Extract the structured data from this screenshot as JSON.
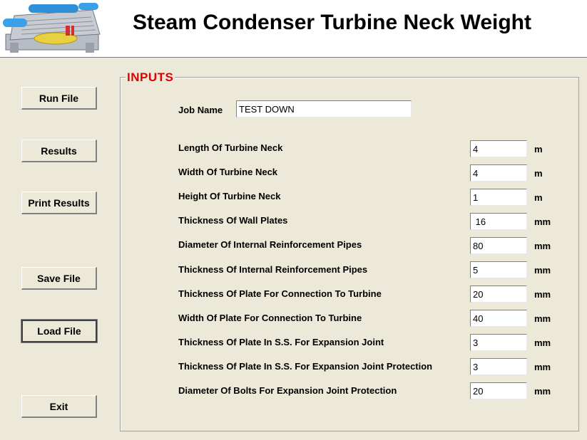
{
  "header": {
    "title": "Steam Condenser Turbine Neck Weight"
  },
  "sidebar": {
    "run_file": "Run File",
    "results": "Results",
    "print_results": "Print Results",
    "save_file": "Save File",
    "load_file": "Load File",
    "exit": "Exit"
  },
  "inputs": {
    "legend": "INPUTS",
    "job_name_label": "Job Name",
    "job_name_value": "TEST DOWN",
    "rows": [
      {
        "label": "Length Of Turbine Neck",
        "value": "4",
        "unit": "m"
      },
      {
        "label": "Width Of Turbine Neck",
        "value": "4",
        "unit": "m"
      },
      {
        "label": "Height Of Turbine Neck",
        "value": "1",
        "unit": "m"
      },
      {
        "label": "Thickness Of Wall Plates",
        "value": " 16",
        "unit": "mm"
      },
      {
        "label": "Diameter Of Internal Reinforcement Pipes",
        "value": "80",
        "unit": "mm"
      },
      {
        "label": "Thickness Of Internal Reinforcement Pipes",
        "value": "5",
        "unit": "mm"
      },
      {
        "label": "Thickness Of Plate For Connection To Turbine",
        "value": "20",
        "unit": "mm"
      },
      {
        "label": "Width Of Plate For Connection To Turbine",
        "value": "40",
        "unit": "mm"
      },
      {
        "label": "Thickness Of Plate In S.S. For Expansion Joint",
        "value": "3",
        "unit": "mm"
      },
      {
        "label": "Thickness Of Plate In S.S. For Expansion Joint Protection",
        "value": "3",
        "unit": "mm"
      },
      {
        "label": "Diameter Of Bolts For Expansion Joint Protection",
        "value": "20",
        "unit": "mm"
      }
    ]
  }
}
